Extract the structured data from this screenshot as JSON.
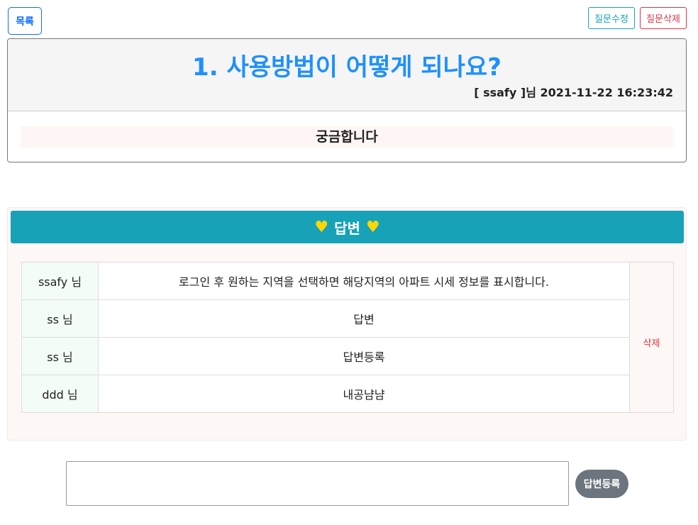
{
  "toolbar": {
    "list_label": "목록",
    "edit_label": "질문수정",
    "delete_label": "질문삭제"
  },
  "question": {
    "title": "1. 사용방법이 어떻게 되나요?",
    "meta": "[ ssafy ]님 2021-11-22 16:23:42",
    "body": "궁금합니다"
  },
  "answers": {
    "header_label": "답변",
    "heart_glyph": "♥",
    "delete_label": "삭제",
    "rows": [
      {
        "author": "ssafy 님",
        "content": "로그인 후 원하는 지역을 선택하면 해당지역의 아파트 시세 정보를 표시합니다."
      },
      {
        "author": "ss 님",
        "content": "답변"
      },
      {
        "author": "ss 님",
        "content": "답변등록"
      },
      {
        "author": "ddd 님",
        "content": "내공냠냠"
      }
    ]
  },
  "composer": {
    "placeholder": "",
    "submit_label": "답변등록"
  },
  "colors": {
    "primary": "#0d6efd",
    "info": "#17a2b8",
    "danger": "#dc3545",
    "title": "#1e90ff",
    "secondary": "#6c757d"
  }
}
